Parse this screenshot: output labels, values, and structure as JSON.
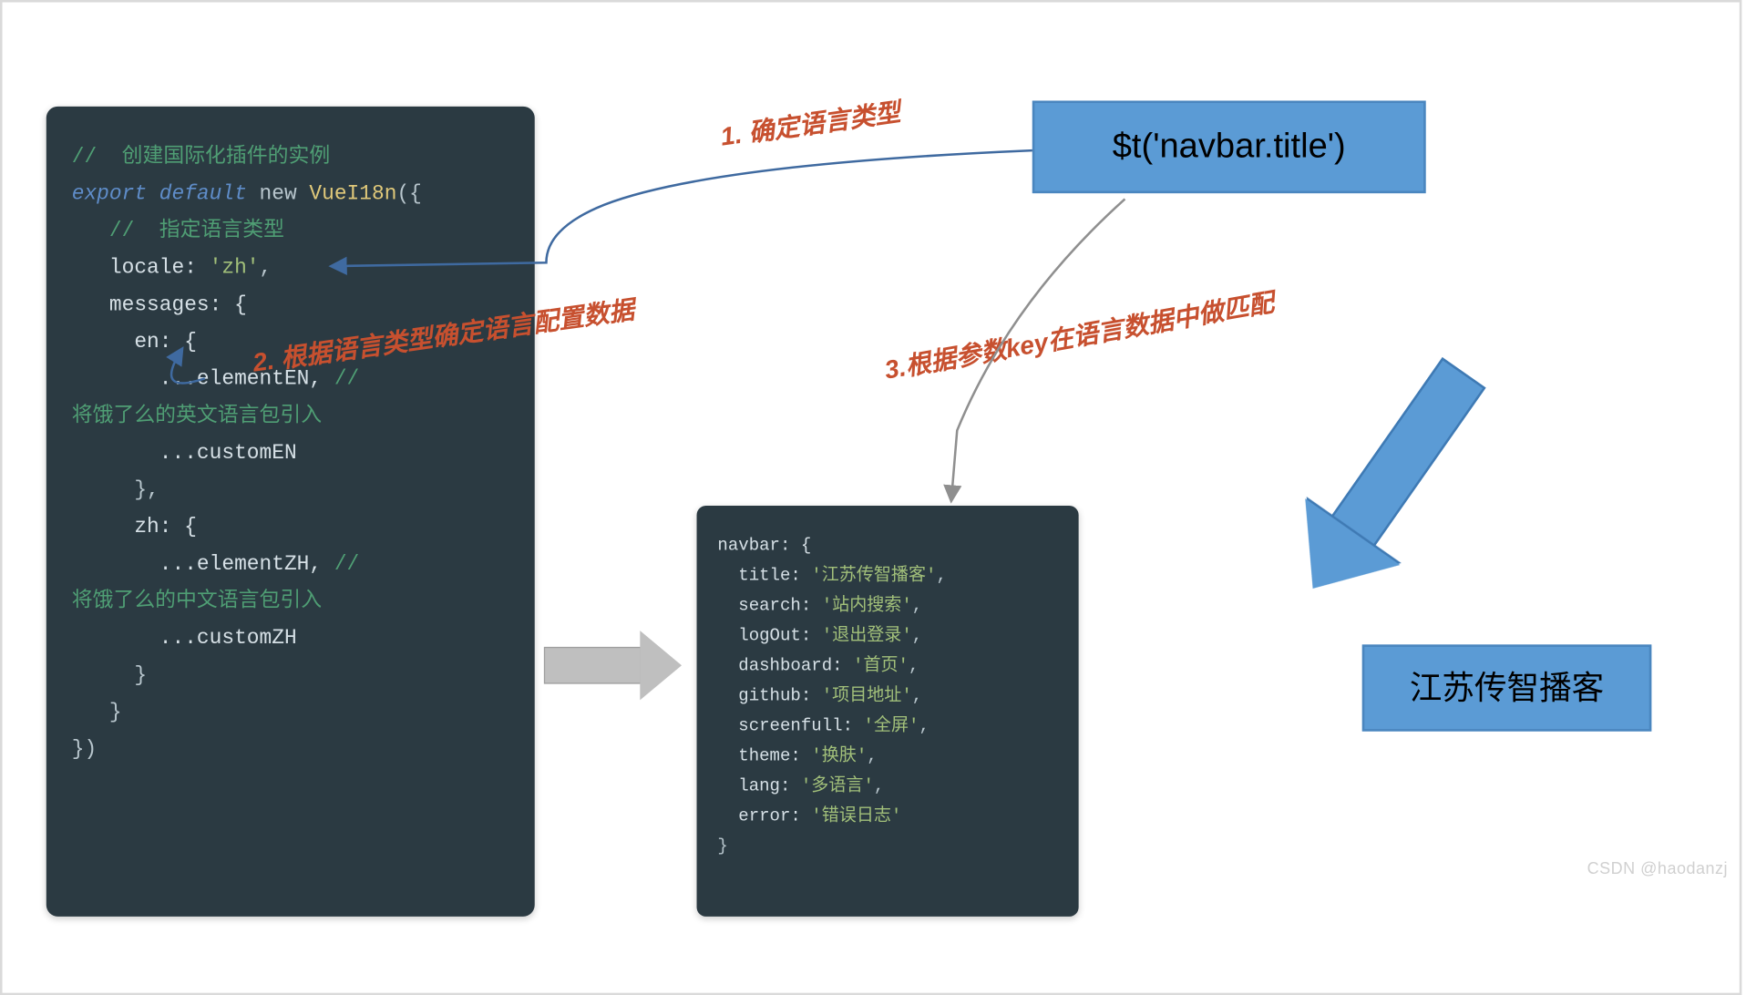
{
  "diagram": {
    "watermark": "CSDN @haodanzj",
    "steps": {
      "s1": "1. 确定语言类型",
      "s2": "2. 根据语言类型确定语言配置数据",
      "s3": "3.根据参数key在语言数据中做匹配"
    },
    "expression": "$t('navbar.title')",
    "result": "江苏传智播客",
    "codeLeft": {
      "l1_comment": "//  创建国际化插件的实例",
      "l2_export": "export",
      "l2_default": " default",
      "l2_new": " new ",
      "l2_type": "VueI18n",
      "l2_open": "({",
      "l3_comment": "   //  指定语言类型",
      "l4": "   locale: ",
      "l4_val": "'zh'",
      "l4_end": ",",
      "l5": "   messages: {",
      "l6": "     en: {",
      "l7": "       ...elementEN,",
      "l7_cmt": " // ",
      "l8_cmt": "将饿了么的英文语言包引入",
      "l9": "       ...customEN",
      "l10": "     },",
      "l11": "     zh: {",
      "l12": "       ...elementZH,",
      "l12_cmt": " // ",
      "l13_cmt": "将饿了么的中文语言包引入",
      "l14": "       ...customZH",
      "l15": "     }",
      "l16": "   }",
      "l17": "})"
    },
    "codeRight": {
      "l1": "navbar: {",
      "k1": "  title: ",
      "v1": "'江苏传智播客'",
      "c": ",",
      "k2": "  search: ",
      "v2": "'站内搜索'",
      "k3": "  logOut: ",
      "v3": "'退出登录'",
      "k4": "  dashboard: ",
      "v4": "'首页'",
      "k5": "  github: ",
      "v5": "'项目地址'",
      "k6": "  screenfull: ",
      "v6": "'全屏'",
      "k7": "  theme: ",
      "v7": "'换肤'",
      "k8": "  lang: ",
      "v8": "'多语言'",
      "k9": "  error: ",
      "v9": "'错误日志'",
      "lend": "}"
    }
  }
}
